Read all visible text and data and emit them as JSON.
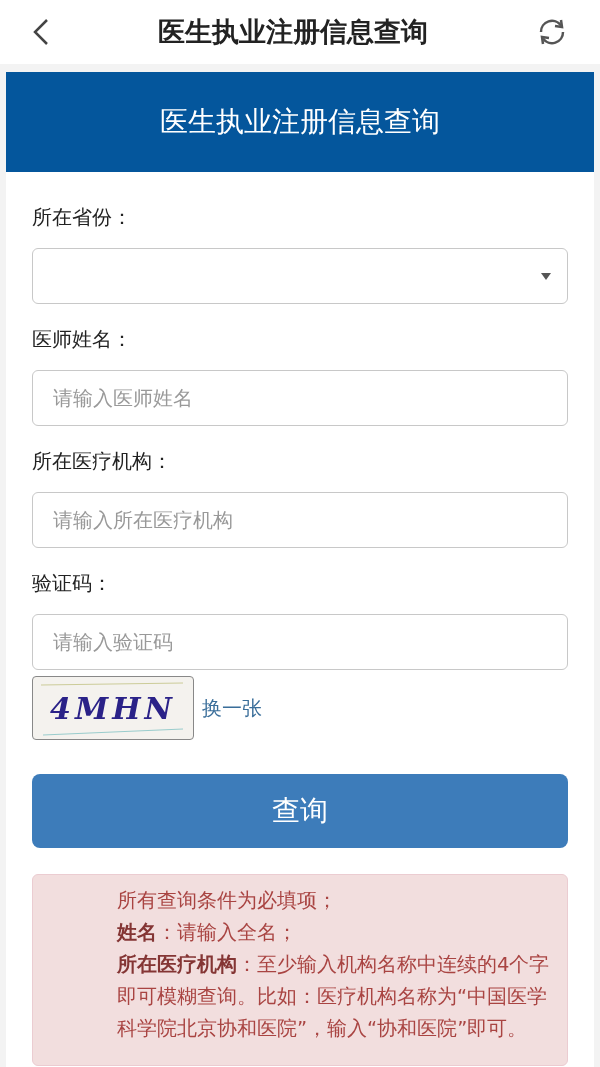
{
  "nav_bar": {
    "title": "医生执业注册信息查询"
  },
  "header": {
    "title": "医生执业注册信息查询"
  },
  "form": {
    "fields": [
      {
        "kind": "select",
        "label": "所在省份："
      },
      {
        "kind": "input",
        "label": "医师姓名：",
        "placeholder": "请输入医师姓名"
      },
      {
        "kind": "input",
        "label": "所在医疗机构：",
        "placeholder": "请输入所在医疗机构"
      },
      {
        "kind": "input",
        "label": "验证码：",
        "placeholder": "请输入验证码"
      }
    ],
    "captcha": {
      "code": "4MHN",
      "refresh_link": "换一张"
    },
    "submit_button": "查询"
  },
  "notice": {
    "lines": [
      "所有查询条件为必填项；",
      "**姓名**：请输入全名；",
      "**所在医疗机构**：至少输入机构名称中连续的4个字即可模糊查询。比如：医疗机构名称为“中国医学科学院北京协和医院”，输入“协和医院”即可。"
    ]
  }
}
